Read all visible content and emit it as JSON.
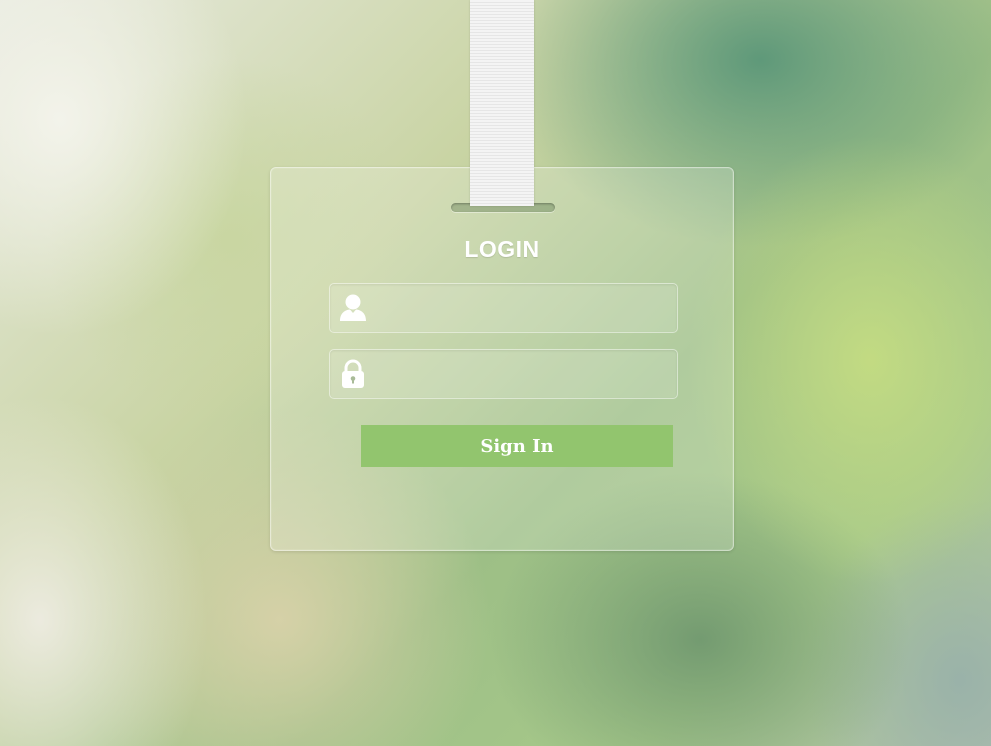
{
  "login": {
    "title": "LOGIN",
    "username": {
      "placeholder": "",
      "value": ""
    },
    "password": {
      "placeholder": "",
      "value": ""
    },
    "sign_in_label": "Sign In"
  },
  "icons": {
    "username": "user-icon",
    "password": "lock-icon"
  },
  "colors": {
    "button": "#92c56e",
    "text": "#ffffff"
  }
}
